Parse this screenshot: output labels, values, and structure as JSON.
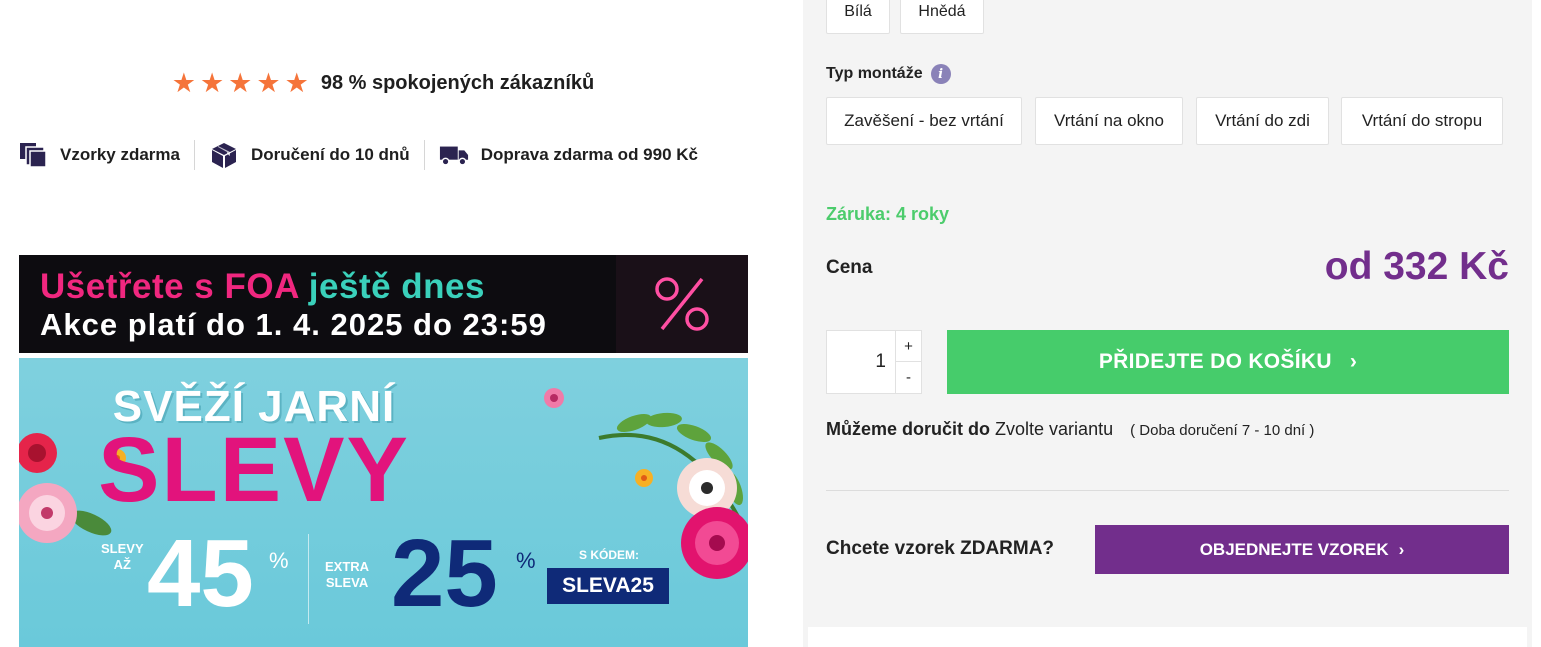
{
  "rating": {
    "stars": 5,
    "text": "98 % spokojených zákazníků",
    "star_color": "#f5743a"
  },
  "usp": [
    {
      "icon": "samples-icon",
      "label": "Vzorky zdarma"
    },
    {
      "icon": "box-icon",
      "label": "Doručení do 10 dnů"
    },
    {
      "icon": "truck-icon",
      "label": "Doprava zdarma od 990 Kč"
    }
  ],
  "banner": {
    "line1_part1": "Ušetřete s FOA",
    "line1_part2": "ještě dnes",
    "line2": "Akce platí do 1. 4. 2025 do 23:59",
    "title1": "SVĚŽÍ JARNÍ",
    "title2": "SLEVY",
    "label_left_1": "SLEVY",
    "label_left_2": "AŽ",
    "big_left": "45",
    "pct": "%",
    "label_mid_1": "EXTRA",
    "label_mid_2": "SLEVA",
    "big_mid": "25",
    "code_label": "S KÓDEM:",
    "code": "SLEVA25"
  },
  "colors": {
    "options": [
      "Bílá",
      "Hnědá"
    ]
  },
  "mounting": {
    "label": "Typ montáže",
    "options": [
      "Zavěšení - bez vrtání",
      "Vrtání na okno",
      "Vrtání do zdi",
      "Vrtání do stropu"
    ]
  },
  "warranty": "Záruka: 4 roky",
  "price": {
    "label": "Cena",
    "value": "od 332 Kč"
  },
  "quantity": {
    "value": "1",
    "plus": "+",
    "minus": "-"
  },
  "cart": {
    "label": "PŘIDEJTE DO KOŠÍKU",
    "chevron": "›"
  },
  "delivery": {
    "bold": "Můžeme doručit do",
    "value": "Zvolte variantu",
    "note": "( Doba doručení 7 - 10 dní )"
  },
  "sample": {
    "question": "Chcete vzorek ZDARMA?",
    "button": "OBJEDNEJTE VZOREK",
    "chevron": "›"
  },
  "theme": {
    "green": "#46cc6b",
    "purple": "#722e8c",
    "pink": "#f0277f",
    "teal": "#3ad1bb"
  }
}
